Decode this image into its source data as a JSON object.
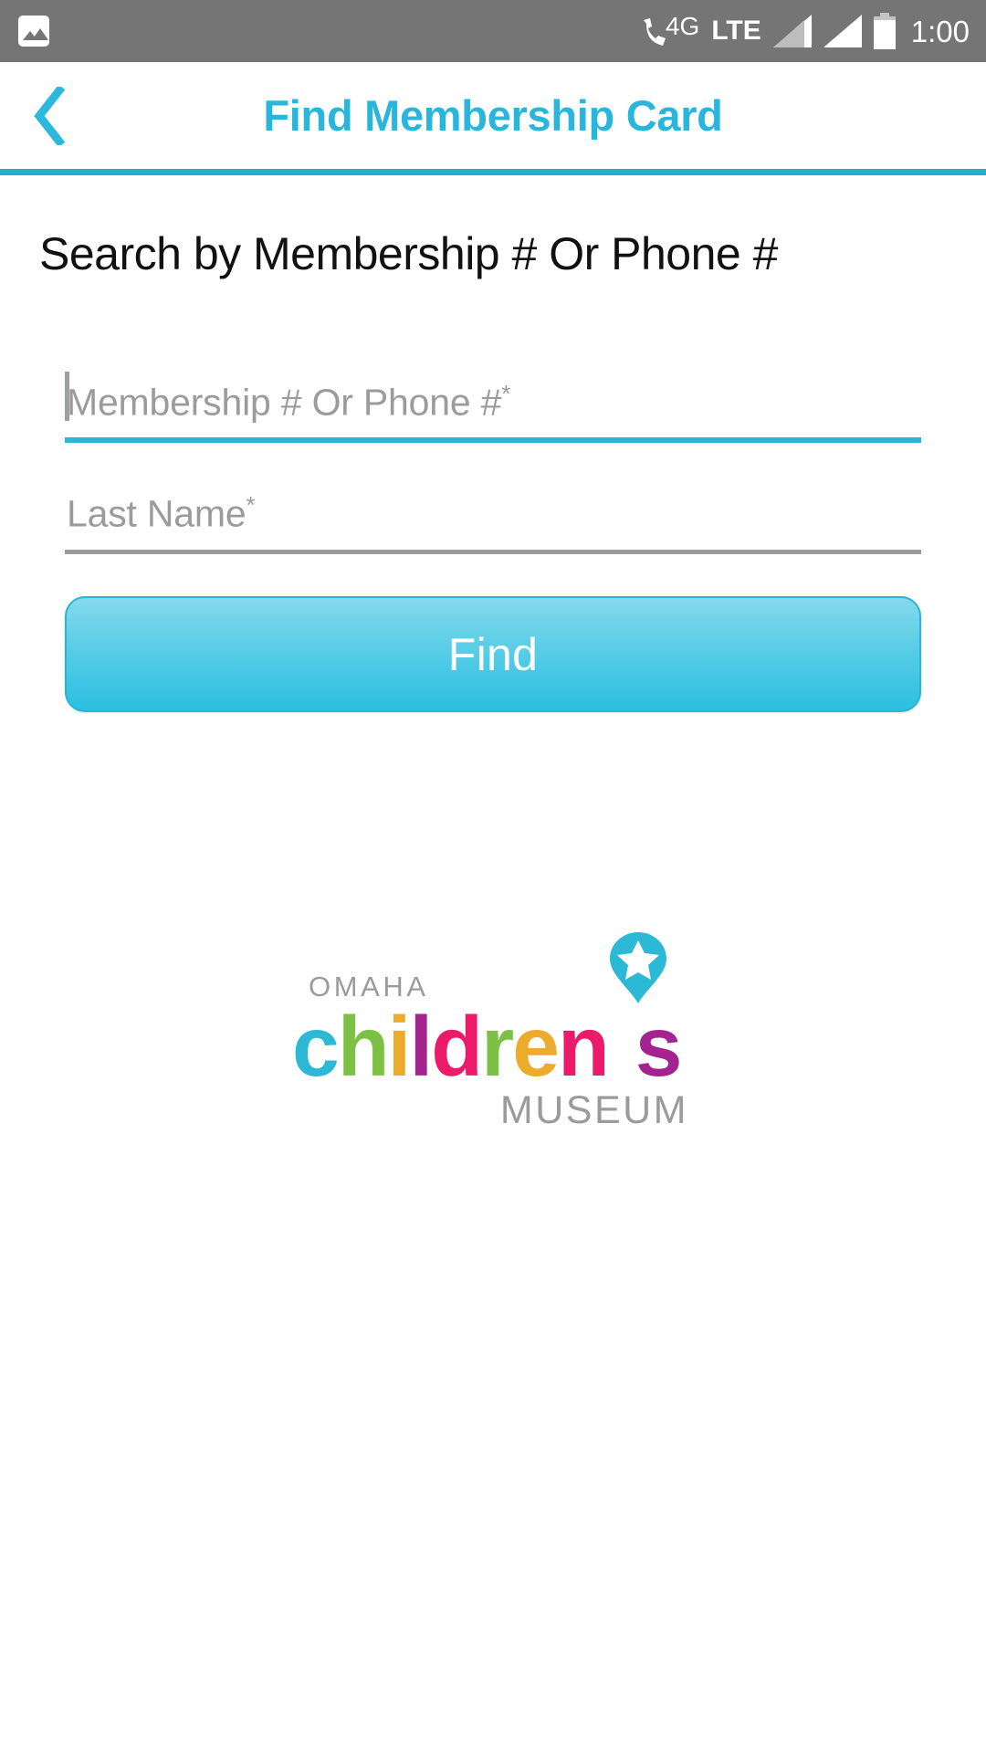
{
  "status_bar": {
    "gallery_icon": "gallery-icon",
    "phone_icon": "phone-icon",
    "network_4g": "4G",
    "network_lte": "LTE",
    "signal_icon_1": "signal-bars-icon",
    "signal_icon_2": "signal-bars-icon",
    "battery_icon": "battery-icon",
    "time": "1:00",
    "background_color": "#757575"
  },
  "app_bar": {
    "back_icon": "chevron-left-icon",
    "title": "Find Membership Card",
    "accent_color": "#29b6dd",
    "divider_color": "#22b0cc"
  },
  "main": {
    "heading": "Search by Membership # Or Phone #",
    "fields": [
      {
        "name": "membership-or-phone",
        "placeholder": "Membership # Or Phone #",
        "required_marker": "*",
        "value": "",
        "focused": true,
        "underline_color": "#2bb7d4"
      },
      {
        "name": "last-name",
        "placeholder": "Last Name",
        "required_marker": "*",
        "value": "",
        "focused": false,
        "underline_color": "#9b9b9b"
      }
    ],
    "submit_button": {
      "label": "Find",
      "gradient_top": "#86d9ec",
      "gradient_bottom": "#2bbfe0",
      "border_color": "#29b4d4",
      "text_color": "#ffffff"
    }
  },
  "logo": {
    "top_word": "OMAHA",
    "bottom_word": "MUSEUM",
    "gray_color": "#9b9b9b",
    "pin_icon": "map-pin-star-icon",
    "pin_color": "#2cb9d6",
    "star_color": "#ffffff",
    "letters": [
      {
        "char": "c",
        "color": "#2cb9d6"
      },
      {
        "char": "h",
        "color": "#7cc143"
      },
      {
        "char": "i",
        "color": "#edab2b"
      },
      {
        "char": "l",
        "color": "#a3248f"
      },
      {
        "char": "d",
        "color": "#ec1b69"
      },
      {
        "char": "r",
        "color": "#7cc143"
      },
      {
        "char": "e",
        "color": "#edab2b"
      },
      {
        "char": "n",
        "color": "#ec1b69"
      },
      {
        "char": "s",
        "color": "#a3248f"
      }
    ]
  }
}
